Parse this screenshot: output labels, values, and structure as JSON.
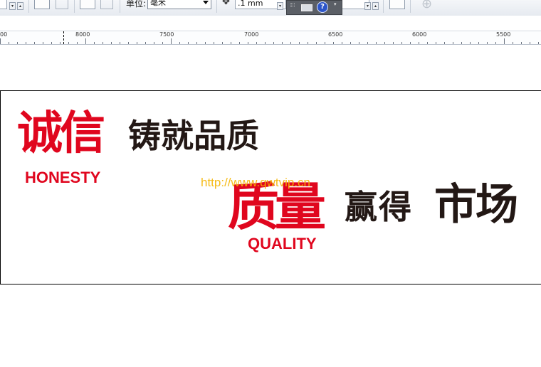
{
  "toolbar": {
    "unit_label": "单位:",
    "unit_value": "毫米",
    "nudge_value": ".1 mm",
    "help_symbol": "?"
  },
  "ruler": {
    "labels": [
      "00",
      "8000",
      "7500",
      "7000",
      "6500",
      "6000",
      "5500"
    ]
  },
  "artwork": {
    "line1_red": "诚信",
    "line1_black": "铸就品质",
    "line1_en": "HONESTY",
    "line2_red": "质量",
    "line2_black_a": "赢得",
    "line2_black_b": "市场",
    "line2_en": "QUALITY",
    "watermark": "http://www.qwtvip.cn"
  },
  "colors": {
    "brand_red": "#e0061e",
    "text_black": "#231815",
    "watermark_yellow": "#f5b400"
  }
}
